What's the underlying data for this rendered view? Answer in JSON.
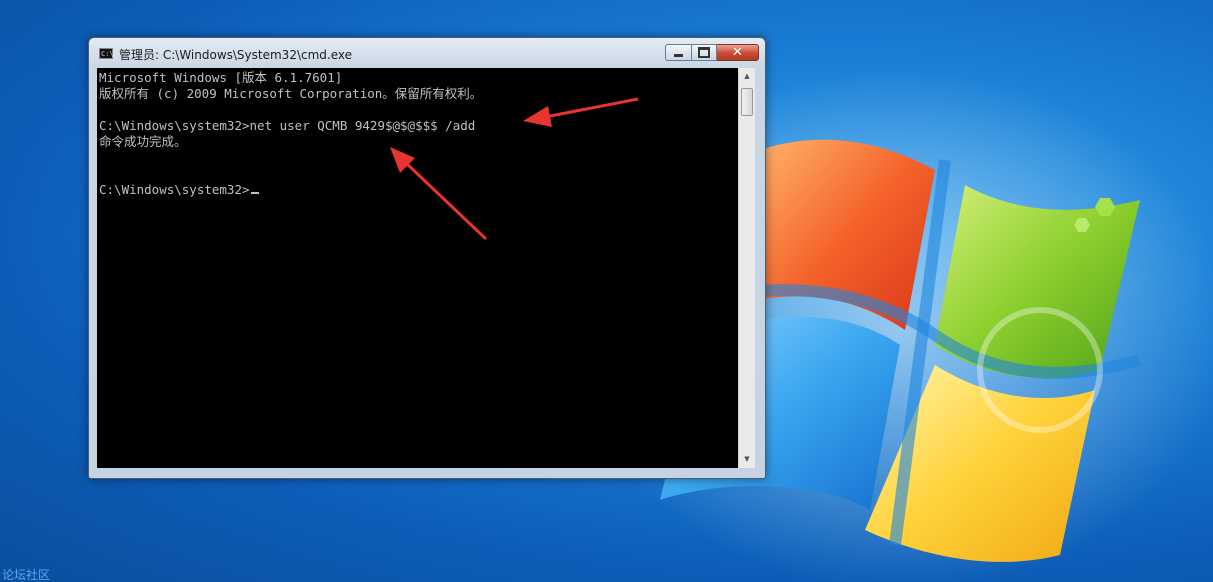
{
  "window": {
    "title": "管理员: C:\\Windows\\System32\\cmd.exe",
    "icon": "cmd-icon",
    "icon_text": "C:\\",
    "min_glyph": "minimize-icon",
    "max_glyph": "maximize-icon",
    "close_glyph": "✕"
  },
  "console": {
    "lines": [
      "Microsoft Windows [版本 6.1.7601]",
      "版权所有 (c) 2009 Microsoft Corporation。保留所有权利。",
      "",
      "C:\\Windows\\system32>net user QCMB 9429$@$@$$$ /add",
      "命令成功完成。",
      "",
      "",
      "C:\\Windows\\system32>"
    ],
    "text_color": "#c0c0c0",
    "background": "#000000"
  },
  "scrollbar": {
    "up_glyph": "▲",
    "down_glyph": "▼"
  },
  "annotations": {
    "arrow_color": "#e8342e"
  },
  "watermark": {
    "text": "论坛社区"
  },
  "colors": {
    "desktop_blue": "#1a7fd6",
    "close_red": "#c84a33"
  }
}
